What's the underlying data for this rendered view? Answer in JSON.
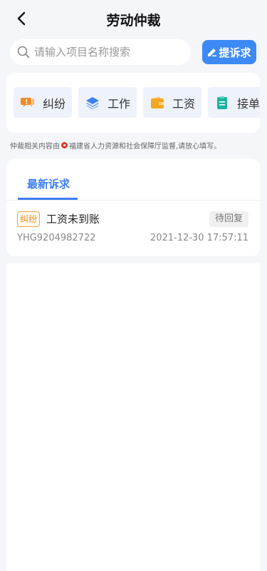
{
  "header": {
    "title": "劳动仲裁"
  },
  "search": {
    "placeholder": "请输入项目名称搜索",
    "value": ""
  },
  "actions": {
    "complaint_label": "提诉求"
  },
  "categories": [
    {
      "label": "纠纷",
      "icon": "chat-bubbles-icon",
      "color": "#f08a2a"
    },
    {
      "label": "工作",
      "icon": "layers-icon",
      "color": "#3d7ef0"
    },
    {
      "label": "工资",
      "icon": "wallet-icon",
      "color": "#f5a623"
    },
    {
      "label": "接单",
      "icon": "clipboard-icon",
      "color": "#1bb3a0"
    }
  ],
  "notice": {
    "prefix": "仲裁相关内容由",
    "suffix": "福建省人力资源和社会保障厅监督,请放心填写。"
  },
  "tabs": {
    "latest_label": "最新诉求"
  },
  "records": [
    {
      "tag": "纠纷",
      "title": "工资未到账",
      "status": "待回复",
      "id": "YHG9204982722",
      "time": "2021-12-30 17:57:11"
    }
  ],
  "colors": {
    "accent": "#3d8af7",
    "tag": "#ee8d1f",
    "background": "#f5f6fa"
  }
}
